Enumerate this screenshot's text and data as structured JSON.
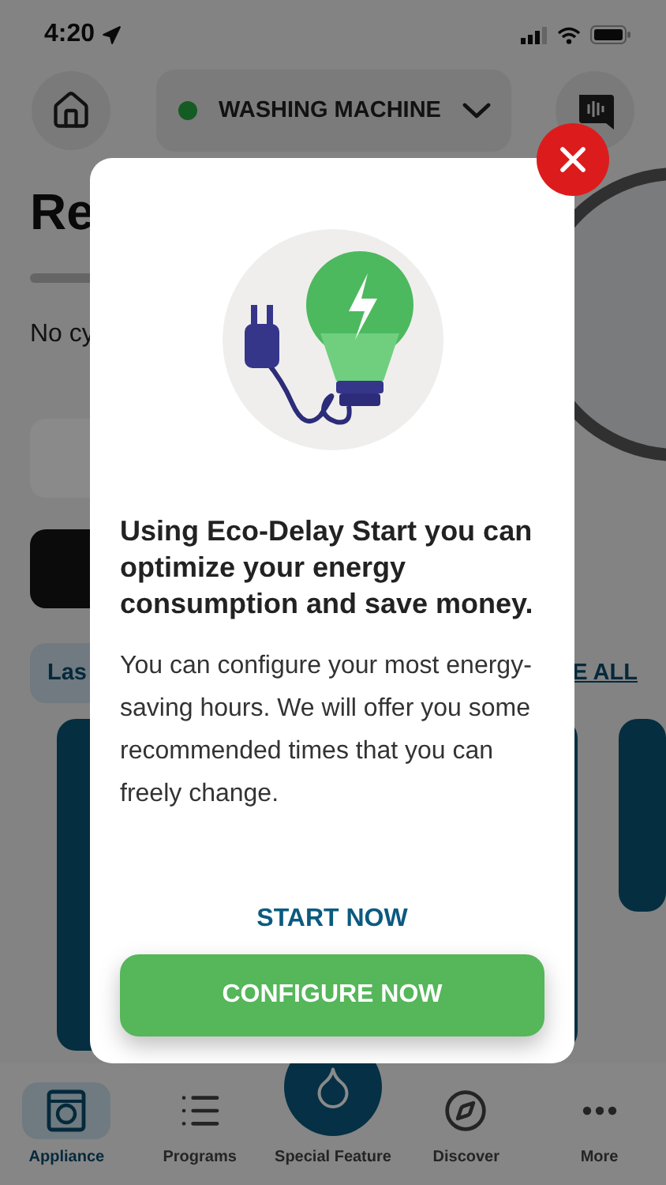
{
  "status_bar": {
    "time": "4:20"
  },
  "header": {
    "device": {
      "name": "WASHING MACHINE",
      "online": true
    }
  },
  "background": {
    "title": "Re",
    "status": "No cy",
    "section_label": "Las",
    "see_all": "E ALL"
  },
  "dialog": {
    "heading": "Using Eco-Delay Start you can optimize your energy consumption and save money.",
    "body": "You can configure your most energy-saving hours. We will offer you some recommended times that you can freely change.",
    "secondary_action": "START NOW",
    "primary_action": "CONFIGURE NOW"
  },
  "tab_bar": [
    {
      "label": "Appliance",
      "kind": "appliance",
      "selected": true
    },
    {
      "label": "Programs",
      "kind": "list",
      "selected": false
    },
    {
      "label": "Special Feature",
      "kind": "feature",
      "selected": false
    },
    {
      "label": "Discover",
      "kind": "compass",
      "selected": false
    },
    {
      "label": "More",
      "kind": "more",
      "selected": false
    }
  ]
}
